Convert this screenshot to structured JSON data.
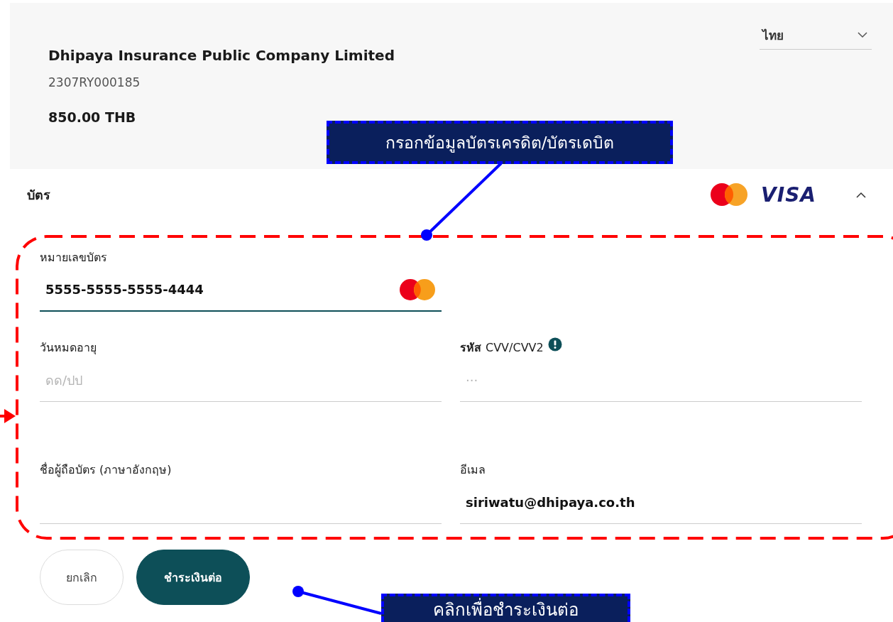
{
  "header": {
    "company": "Dhipaya Insurance Public Company Limited",
    "reference": "2307RY000185",
    "amount": "850.00 THB",
    "language": "ไทย"
  },
  "card_section": {
    "title": "บัตร",
    "expanded": true,
    "brand_text": "VISA"
  },
  "fields": [
    {
      "kind": "card",
      "label": "หมายเลขบัตร",
      "value": "5555-5555-5555-4444",
      "focused": true
    },
    {
      "kind": "text",
      "label": "วันหมดอายุ",
      "placeholder": "ดด/ปป",
      "focused": false
    },
    {
      "kind": "text",
      "label": "**รหัส** CVV/CVV2",
      "placeholder": "···",
      "info": true,
      "focused": false
    },
    {
      "kind": "text",
      "label": "ชื่อผู้ถือบัตร (ภาษาอังกฤษ)",
      "focused": false
    },
    {
      "kind": "text",
      "label": "อีเมล",
      "value": "siriwatu@dhipaya.co.th",
      "focused": false
    }
  ],
  "buttons": [
    {
      "label": "ยกเลิก",
      "kind": "secondary"
    },
    {
      "label": "ชำระเงินต่อ",
      "kind": "primary"
    }
  ],
  "annotations": [
    {
      "text": "กรอกข้อมูลบัตรเครดิต/บัตรเดบิต"
    },
    {
      "text": "คลิกเพื่อชำระเงินต่อ"
    }
  ]
}
